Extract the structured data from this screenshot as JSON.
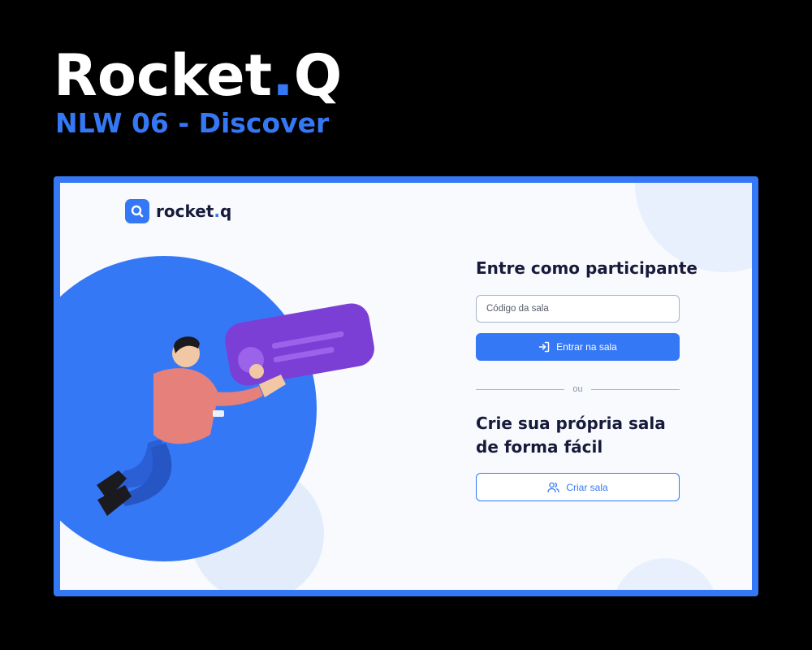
{
  "poster": {
    "title_main": "Rocket",
    "title_dot": ".",
    "title_end": "Q",
    "subtitle": "NLW 06 - Discover"
  },
  "app": {
    "logo": {
      "text_main": "rocket",
      "text_dot": ".",
      "text_end": "q",
      "icon": "search-bubble-icon"
    },
    "join": {
      "heading": "Entre como participante",
      "input_placeholder": "Código da sala",
      "input_value": "",
      "button_label": "Entrar na sala",
      "button_icon": "log-in-icon"
    },
    "divider_label": "ou",
    "create": {
      "heading": "Crie sua própria sala de forma fácil",
      "button_label": "Criar sala",
      "button_icon": "users-icon"
    }
  },
  "colors": {
    "background": "#000000",
    "accent": "#3578f5",
    "heading_text": "#171b3b",
    "app_background": "#f8fafd",
    "illustration_card": "#7b3fd6"
  }
}
